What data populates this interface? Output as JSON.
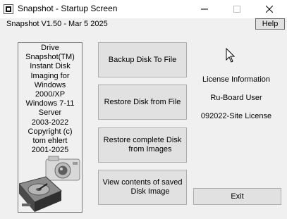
{
  "window": {
    "title": "Snapshot - Startup Screen",
    "controls": {
      "minimize": "—",
      "maximize": "☐",
      "close": "✕"
    }
  },
  "header": {
    "version": "Snapshot V1.50 - Mar  5 2025",
    "help_label": "Help"
  },
  "about_panel": {
    "lines": [
      "Drive",
      "Snapshot(TM)",
      "Instant Disk",
      "Imaging for",
      "Windows",
      "2000/XP",
      "Windows 7-11",
      "Server",
      "2003-2022",
      "Copyright (c)",
      "tom ehlert",
      "2001-2025"
    ]
  },
  "actions": {
    "backup": {
      "line1": "Backup Disk To File"
    },
    "restore": {
      "line1": "Restore Disk from File"
    },
    "restore_complete": {
      "line1": "Restore complete Disk",
      "line2": "from Images"
    },
    "view_contents": {
      "line1": "View contents of saved",
      "line2": "Disk Image"
    }
  },
  "license": {
    "heading": "License Information",
    "user": "Ru-Board User",
    "type": "092022-Site License"
  },
  "exit_label": "Exit",
  "icons": {
    "app": "snapshot-app-icon",
    "illustration": "hard-drive-and-camera-illustration",
    "cursor": "mouse-pointer-icon"
  },
  "colors": {
    "background": "#f0f0f0",
    "titlebar": "#ffffff",
    "button_face": "#e1e1e1",
    "button_border": "#adadad"
  }
}
